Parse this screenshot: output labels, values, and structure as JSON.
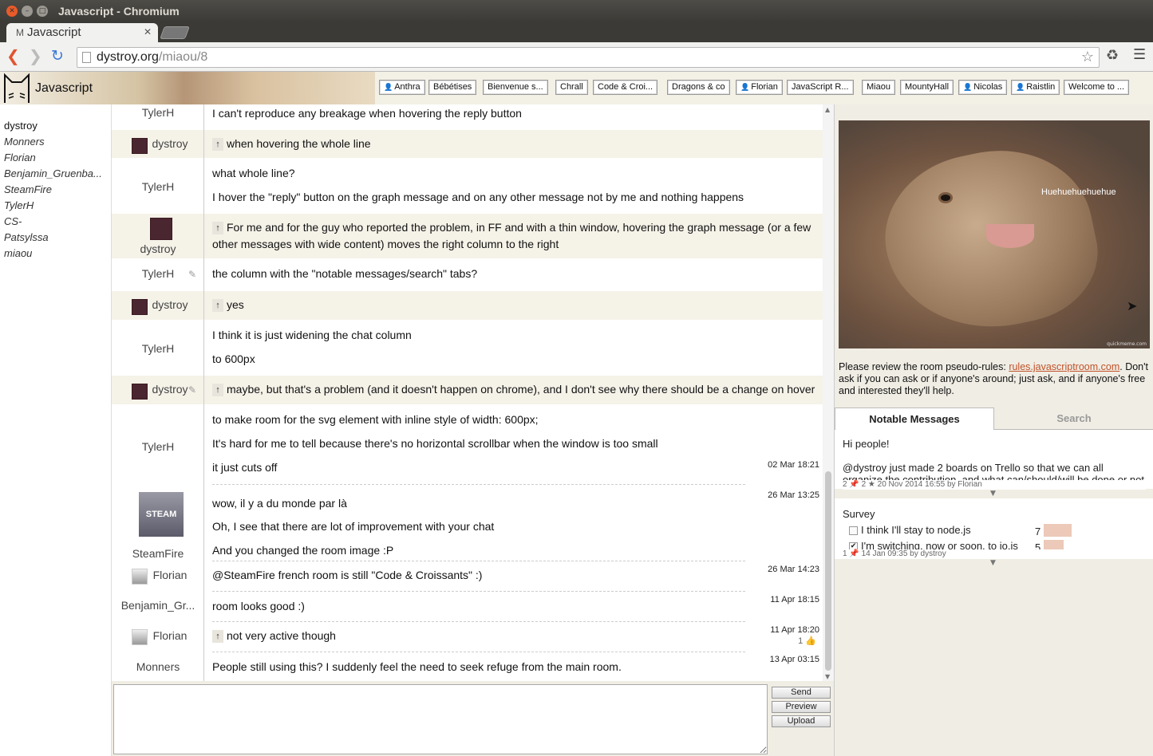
{
  "window": {
    "title": "Javascript - Chromium",
    "tab_title": "Javascript",
    "tab_favicon": "M"
  },
  "browser": {
    "url_host": "dystroy.org",
    "url_path": "/miaou/8"
  },
  "app": {
    "room_name": "Javascript"
  },
  "room_tabs": [
    {
      "label": "Anthra",
      "private": true
    },
    {
      "label": "Bébétises",
      "private": false
    },
    {
      "label": "Bienvenue s...",
      "private": false
    },
    {
      "label": "Chrall",
      "private": false
    },
    {
      "label": "Code & Croi...",
      "private": false
    },
    {
      "label": "Dragons & co",
      "private": false
    },
    {
      "label": "Florian",
      "private": true
    },
    {
      "label": "JavaScript R...",
      "private": false
    },
    {
      "label": "Miaou",
      "private": false
    },
    {
      "label": "MountyHall",
      "private": false
    },
    {
      "label": "Nicolas",
      "private": true
    },
    {
      "label": "Raistlin",
      "private": true
    },
    {
      "label": "Welcome to ...",
      "private": false
    }
  ],
  "users": [
    "dystroy",
    "Monners",
    "Florian",
    "Benjamin_Gruenba...",
    "SteamFire",
    "TylerH",
    "CS-",
    "Patsylssa",
    "miaou"
  ],
  "messages": [
    {
      "author": "TylerH",
      "lines": [
        "I can't reproduce any breakage when hovering the reply button"
      ]
    },
    {
      "author": "dystroy",
      "lines": [
        "when hovering the whole line"
      ]
    },
    {
      "author": "TylerH",
      "lines": [
        "what whole line?",
        "I hover the \"reply\" button on the graph message and on any other message not by me and nothing happens"
      ]
    },
    {
      "author": "dystroy",
      "lines": [
        "For me and for the guy who reported the problem, in FF and with a thin window, hovering the graph message (or a few",
        "other messages with wide content) moves the right column to the right"
      ]
    },
    {
      "author": "TylerH",
      "lines": [
        "the column with the \"notable messages/search\" tabs?"
      ]
    },
    {
      "author": "dystroy",
      "lines": [
        "yes"
      ]
    },
    {
      "author": "TylerH",
      "lines": [
        "I think it is just widening the chat column",
        "to 600px"
      ]
    },
    {
      "author": "dystroy",
      "lines": [
        "maybe, but that's a problem (and it doesn't happen on chrome), and I don't see why there should be a change on hover"
      ]
    },
    {
      "author": "TylerH",
      "lines": [
        "to make room for the svg element with inline style of width: 600px;",
        "It's hard for me to tell because there's no horizontal scrollbar when the window is too small",
        "it just cuts off"
      ],
      "time": "02 Mar 18:21"
    },
    {
      "author": "SteamFire",
      "avatar_text": "STEAM",
      "lines": [
        "wow, il y a du monde par là",
        "Oh, I see that there are lot of improvement with your chat",
        "And you changed the room image :P"
      ],
      "time": "26 Mar 13:25"
    },
    {
      "author": "Florian",
      "lines": [
        "@SteamFire french room is still \"Code & Croissants\" :)"
      ],
      "time": "26 Mar 14:23"
    },
    {
      "author": "Benjamin_Gr...",
      "lines": [
        "room looks good :)"
      ],
      "time": "11 Apr 18:15"
    },
    {
      "author": "Florian",
      "lines": [
        "not very active though"
      ],
      "time": "11 Apr 18:20",
      "votes": "1"
    },
    {
      "author": "Monners",
      "lines": [
        "People still using this? I suddenly feel the need to seek refuge from the main room."
      ],
      "time": "13 Apr 03:15"
    }
  ],
  "input": {
    "send": "Send",
    "preview": "Preview",
    "upload": "Upload"
  },
  "room_image": {
    "caption": "Huehuehuehuehue",
    "credit": "quickmeme.com"
  },
  "room_description": {
    "text": "Please review the room pseudo-rules: ",
    "link": "rules.javascriptroom.com",
    "text2": ". Don't ask if you can ask or if anyone's around; just ask, and if anyone's free and interested they'll help."
  },
  "tabs": {
    "notable": "Notable Messages",
    "search": "Search"
  },
  "notable_messages": [
    {
      "lines": [
        "Hi people!",
        "@dystroy just made 2 boards on Trello so that we can all",
        "organize the contribution, and what can/should/will be done or not"
      ],
      "meta": "2 📌 2 ★ 20 Nov 2014 16:55 by Florian"
    },
    {
      "title": "Survey",
      "poll": [
        {
          "label": "I think I'll stay to node.js",
          "count": "7",
          "fraction": 0.58,
          "checked": false
        },
        {
          "label": "I'm switching, now or soon, to io.js",
          "count": "5",
          "fraction": 0.42,
          "checked": true
        }
      ],
      "meta": "1 📌 14 Jan 09:35 by dystroy"
    }
  ],
  "colors": {
    "accent_link": "#c0522a",
    "me_bg": "#f5f2e8",
    "panel_bg": "#f0ede4"
  }
}
